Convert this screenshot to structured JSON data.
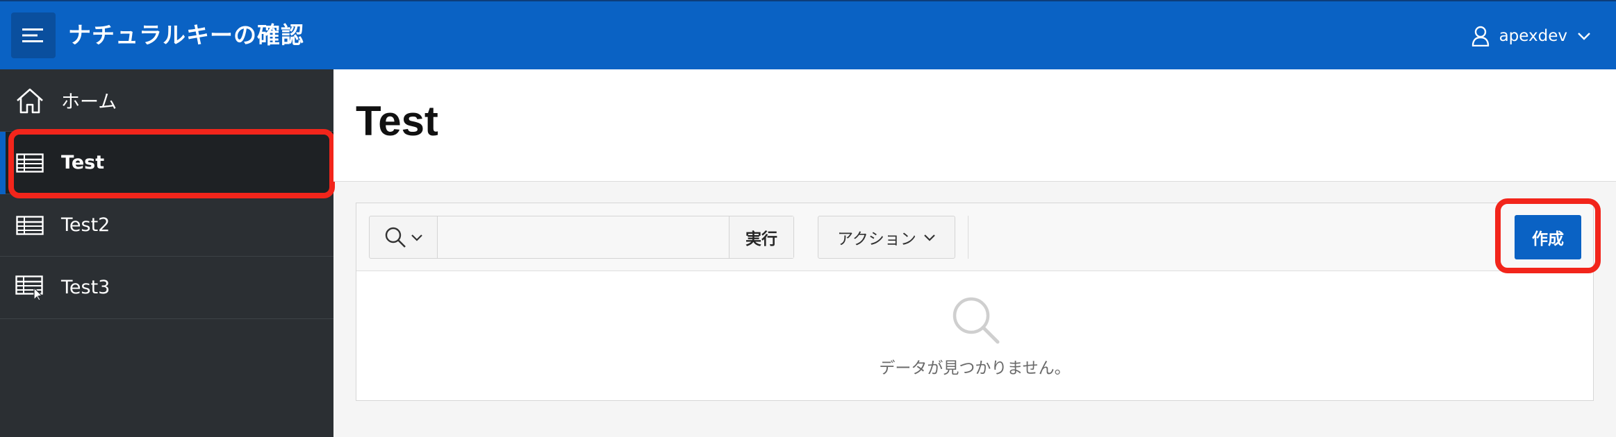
{
  "header": {
    "app_title": "ナチュラルキーの確認",
    "user_name": "apexdev",
    "menu_icon": "hamburger-menu-icon",
    "user_icon": "user-icon",
    "bg_color": "#0a62c4"
  },
  "sidebar": {
    "items": [
      {
        "label": "ホーム",
        "icon": "home-icon"
      },
      {
        "label": "Test",
        "icon": "table-icon",
        "active": true
      },
      {
        "label": "Test2",
        "icon": "table-icon"
      },
      {
        "label": "Test3",
        "icon": "table-cursor-icon"
      }
    ]
  },
  "page": {
    "title": "Test"
  },
  "report": {
    "search_placeholder": "",
    "search_value": "",
    "go_label": "実行",
    "actions_label": "アクション",
    "create_label": "作成",
    "empty_message": "データが見つかりません。"
  },
  "annotations": {
    "highlight_color": "#f2251b"
  }
}
